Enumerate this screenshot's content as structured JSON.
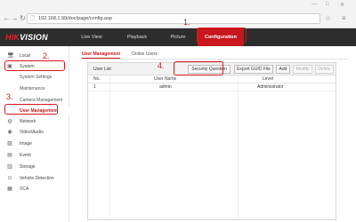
{
  "browser": {
    "url": "192.168.1.99/doc/page/config.asp",
    "back_icon": "←",
    "forward_icon": "→",
    "reload_icon": "↻",
    "page_icon": "🗋",
    "star_icon": "☆",
    "menu_icon": "≡",
    "minimize_icon": "—",
    "maximize_icon": "□",
    "close_icon": "✕"
  },
  "header": {
    "logo_prefix": "HIK",
    "logo_suffix": "VISION",
    "nav": [
      {
        "label": "Live View"
      },
      {
        "label": "Playback"
      },
      {
        "label": "Picture"
      },
      {
        "label": "Configuration"
      }
    ]
  },
  "sidebar": {
    "items": [
      {
        "label": "Local",
        "icon": "🖥"
      },
      {
        "label": "System",
        "icon": "▣"
      },
      {
        "label": "System Settings"
      },
      {
        "label": "Maintenance"
      },
      {
        "label": "Camera Management"
      },
      {
        "label": "User Management"
      },
      {
        "label": "Network",
        "icon": "◍"
      },
      {
        "label": "Video/Audio",
        "icon": "◉"
      },
      {
        "label": "Image",
        "icon": "▨"
      },
      {
        "label": "Event",
        "icon": "▤"
      },
      {
        "label": "Storage",
        "icon": "▥"
      },
      {
        "label": "Vehicle Detection",
        "icon": "⊙"
      },
      {
        "label": "VCA",
        "icon": "▦"
      }
    ]
  },
  "main": {
    "tabs": [
      {
        "label": "User Management"
      },
      {
        "label": "Online Users"
      }
    ],
    "panel": {
      "title": "User List",
      "buttons": {
        "security_question": "Security Question",
        "export_guid": "Export GUID File",
        "add": "Add",
        "modify": "Modify",
        "delete": "Delete"
      },
      "columns": {
        "no": "No.",
        "user": "User Name",
        "level": "Level"
      },
      "rows": [
        {
          "no": "1",
          "user": "admin",
          "level": "Administrator"
        }
      ]
    }
  },
  "annotations": {
    "one": "1.",
    "two": "2.",
    "three": "3.",
    "four": "4.",
    "color": "#d9161d"
  },
  "colors": {
    "header_bg": "#2d2d2d",
    "accent": "#c8161d"
  }
}
